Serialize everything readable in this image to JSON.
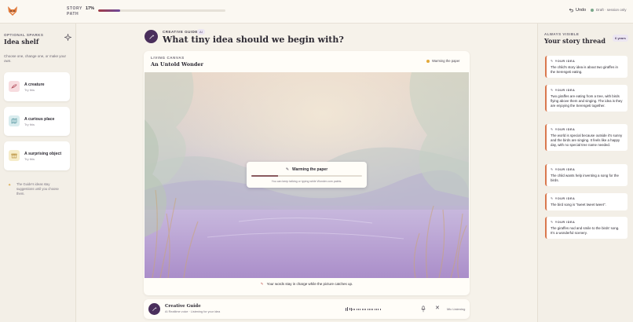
{
  "topbar": {
    "story_path_label": "STORY PATH",
    "story_path_percent": "17%",
    "story_path_progress": 0.17,
    "undo_label": "Undo",
    "draft_label": "Draft · session only"
  },
  "left": {
    "kicker": "OPTIONAL SPARKS",
    "title": "Idea shelf",
    "description": "Choose one, change one, or make your own.",
    "sparks": [
      {
        "title": "A creature",
        "sub": "Try this",
        "icon": "paw-icon",
        "color": "#f7dcdf",
        "ink": "#b24c5a"
      },
      {
        "title": "A curious place",
        "sub": "Try this",
        "icon": "map-icon",
        "color": "#d9ecee",
        "ink": "#3f8793"
      },
      {
        "title": "A surprising object",
        "sub": "Try this",
        "icon": "gift-icon",
        "color": "#f6ecc9",
        "ink": "#b4882f"
      }
    ],
    "note": "The Guide's ideas stay suggestions until you choose them."
  },
  "guide": {
    "kicker": "CREATIVE GUIDE",
    "badge": "AI",
    "question": "What tiny idea should we begin with?"
  },
  "canvas": {
    "kicker": "LIVING CANVAS",
    "title": "An Untold Wonder",
    "status": "Warming the paper",
    "footer": "Your words stay in charge while the picture catches up.",
    "dialog": {
      "title": "Warming the paper",
      "progress": 0.24,
      "sub": "You can keep talking or typing while Wonder.com paints."
    }
  },
  "voice": {
    "name": "Creative Guide",
    "sub": "AI Realtime voice · Listening for your idea",
    "status": "Mic Listening"
  },
  "right": {
    "kicker": "ALWAYS VISIBLE",
    "title": "Your story thread",
    "badge": "6 years",
    "idea_label": "YOUR IDEA",
    "ideas": [
      "The child's story idea is about two giraffes in the Serengeti eating.",
      "Two giraffes are eating from a tree, with birds flying above them and singing. The idea is they are enjoying the Serengeti together.",
      "The world is special because outside it's sunny and the birds are singing. It feels like a happy day, with no special tree name needed.",
      "The child wants help inventing a song for the birds.",
      "The bird song is \"tweet tweet tweet\".",
      "The giraffes nod and smile to the birds' song. It's a wonderful scenery."
    ]
  },
  "colors": {
    "accent": "#4a2f5c",
    "idea_border": "#d9784e",
    "warm_dot": "#e3a93a",
    "progress_start": "#a23c46",
    "progress_end": "#6d4a9c"
  }
}
